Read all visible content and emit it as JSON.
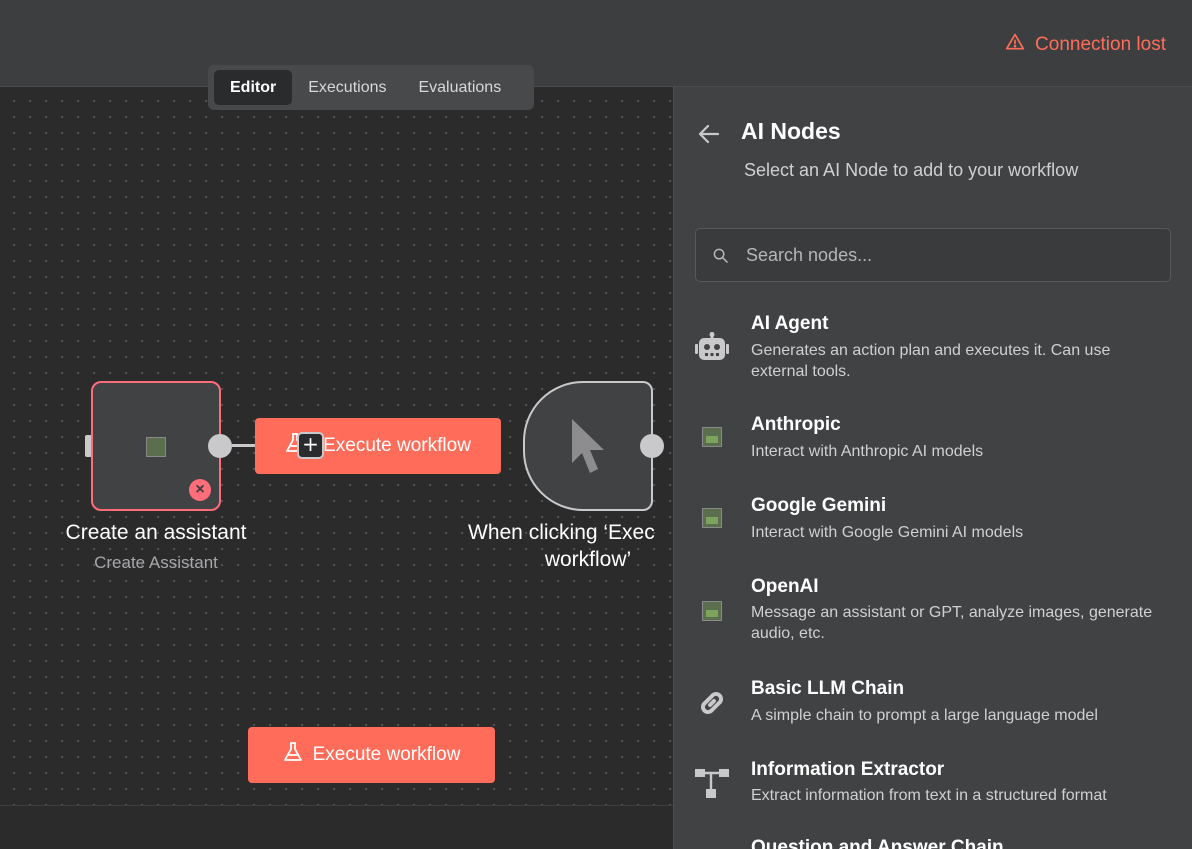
{
  "header": {
    "connection_status": "Connection lost"
  },
  "tabs": [
    {
      "label": "Editor",
      "active": true
    },
    {
      "label": "Executions",
      "active": false
    },
    {
      "label": "Evaluations",
      "active": false
    }
  ],
  "canvas": {
    "nodes": [
      {
        "title": "Create an assistant",
        "subtitle": "Create Assistant",
        "status": "error"
      },
      {
        "title_line1": "When clicking ‘Exec",
        "title_line2": "workflow’"
      }
    ],
    "execute_overlay_label": "Execute workflow",
    "execute_button_label": "Execute workflow",
    "plus_label": "+"
  },
  "panel": {
    "title": "AI Nodes",
    "subtitle": "Select an AI Node to add to your workflow",
    "search_placeholder": "Search nodes...",
    "items": [
      {
        "name": "AI Agent",
        "description": "Generates an action plan and executes it. Can use external tools.",
        "icon": "robot-icon"
      },
      {
        "name": "Anthropic",
        "description": "Interact with Anthropic AI models",
        "icon": "broken-image-icon"
      },
      {
        "name": "Google Gemini",
        "description": "Interact with Google Gemini AI models",
        "icon": "broken-image-icon"
      },
      {
        "name": "OpenAI",
        "description": "Message an assistant or GPT, analyze images, generate audio, etc.",
        "icon": "broken-image-icon"
      },
      {
        "name": "Basic LLM Chain",
        "description": "A simple chain to prompt a large language model",
        "icon": "link-icon"
      },
      {
        "name": "Information Extractor",
        "description": "Extract information from text in a structured format",
        "icon": "sitemap-icon"
      },
      {
        "name": "Question and Answer Chain",
        "description": "",
        "icon": "link-icon"
      }
    ]
  },
  "colors": {
    "accent": "#ff6d5a",
    "error": "#ff6d7a"
  }
}
